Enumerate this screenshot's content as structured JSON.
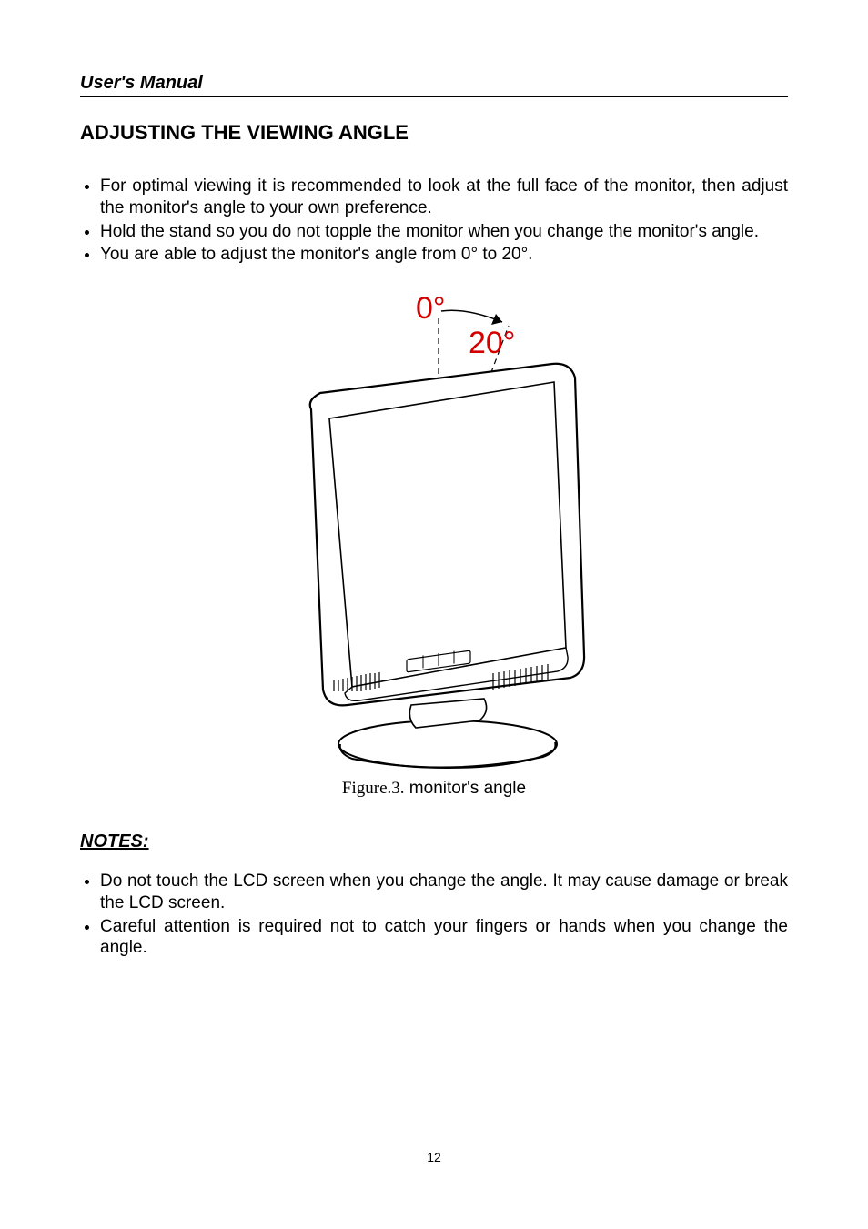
{
  "header": {
    "title": "User's Manual"
  },
  "section": {
    "title": "ADJUSTING THE VIEWING ANGLE"
  },
  "bullets": {
    "items": [
      "For optimal viewing it is recommended to look at the full face of the monitor, then adjust the monitor's angle to your own preference.",
      "Hold the stand so you do not topple the monitor when you change the monitor's angle.",
      "You are able to adjust the monitor's angle from 0° to 20°."
    ]
  },
  "figure": {
    "angle0_label": "0°",
    "angle20_label": "20°",
    "caption_prefix": "Figure.3.",
    "caption_text": " monitor's angle",
    "angle_color": "#d40000"
  },
  "notes": {
    "title": "NOTES:",
    "items": [
      "Do not touch the LCD screen when you change the angle. It may cause damage or break the LCD screen.",
      "Careful attention is required not to catch your fingers or hands when you change the angle."
    ]
  },
  "page_number": "12"
}
